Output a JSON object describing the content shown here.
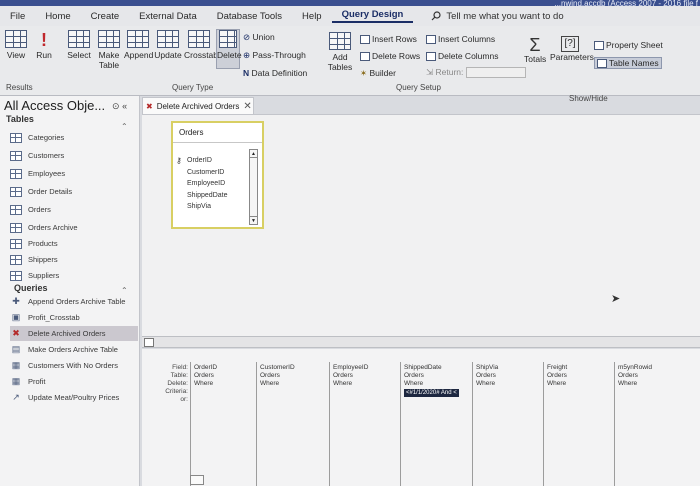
{
  "window": {
    "title": "...nwind.accdb (Access 2007 - 2016 file f"
  },
  "menu": {
    "tabs": [
      "File",
      "Home",
      "Create",
      "External Data",
      "Database Tools",
      "Help",
      "Query Design"
    ],
    "tell_me": "Tell me what you want to do"
  },
  "ribbon": {
    "results": {
      "view": "View",
      "run": "Run",
      "group": "Results"
    },
    "query_type": {
      "select": "Select",
      "make_table_1": "Make",
      "make_table_2": "Table",
      "append": "Append",
      "update": "Update",
      "crosstab": "Crosstab",
      "delete": "Delete",
      "union": "Union",
      "pass_through": "Pass-Through",
      "data_definition": "Data Definition",
      "group": "Query Type"
    },
    "query_setup": {
      "add_tables_1": "Add",
      "add_tables_2": "Tables",
      "insert_rows": "Insert Rows",
      "delete_rows": "Delete Rows",
      "builder": "Builder",
      "insert_columns": "Insert Columns",
      "delete_columns": "Delete Columns",
      "return": "Return:",
      "group": "Query Setup"
    },
    "show_hide": {
      "totals": "Totals",
      "parameters": "Parameters",
      "property_sheet": "Property Sheet",
      "table_names": "Table Names",
      "group": "Show/Hide"
    }
  },
  "nav": {
    "title": "All Access Obje...",
    "tables_label": "Tables",
    "tables": [
      "Categories",
      "Customers",
      "Employees",
      "Order Details",
      "Orders",
      "Orders Archive",
      "Products",
      "Shippers",
      "Suppliers"
    ],
    "queries_label": "Queries",
    "queries": [
      "Append Orders Archive Table",
      "Profit_Crosstab",
      "Delete Archived Orders",
      "Make Orders Archive Table",
      "Customers With No Orders",
      "Profit",
      "Update Meat/Poultry Prices"
    ]
  },
  "doc_tab": {
    "label": "Delete Archived Orders"
  },
  "table_box": {
    "title": "Orders",
    "fields": [
      "OrderID",
      "CustomerID",
      "EmployeeID",
      "ShippedDate",
      "ShipVia"
    ]
  },
  "grid": {
    "row_labels": [
      "Field:",
      "Table:",
      "Delete:",
      "Criteria:",
      "or:"
    ],
    "columns": [
      {
        "field": "OrderID",
        "table": "Orders",
        "delete": "Where",
        "criteria": ""
      },
      {
        "field": "CustomerID",
        "table": "Orders",
        "delete": "Where",
        "criteria": ""
      },
      {
        "field": "EmployeeID",
        "table": "Orders",
        "delete": "Where",
        "criteria": ""
      },
      {
        "field": "ShippedDate",
        "table": "Orders",
        "delete": "Where",
        "criteria": "<#1/1/2020# And <"
      },
      {
        "field": "ShipVia",
        "table": "Orders",
        "delete": "Where",
        "criteria": ""
      },
      {
        "field": "Freight",
        "table": "Orders",
        "delete": "Where",
        "criteria": ""
      },
      {
        "field": "m5ynRowid",
        "table": "Orders",
        "delete": "Where",
        "criteria": ""
      }
    ]
  },
  "colors": {
    "accent": "#1b2e66",
    "selected_nav": "#cbc8cf",
    "table_border": "#d8cf63"
  }
}
